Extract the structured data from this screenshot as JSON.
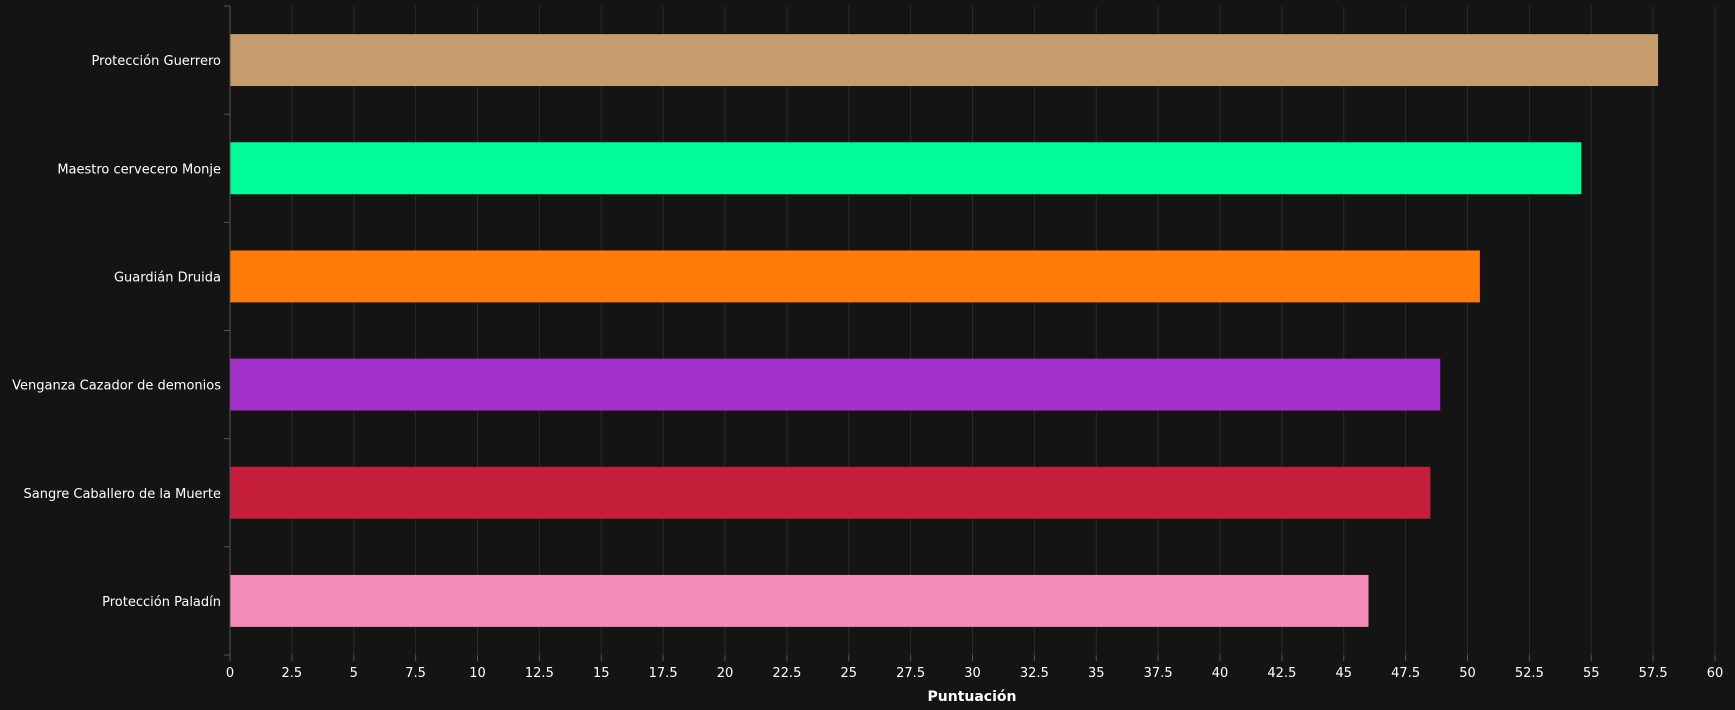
{
  "chart_data": {
    "type": "bar",
    "orientation": "horizontal",
    "categories": [
      "Protección Guerrero",
      "Maestro cervecero Monje",
      "Guardián Druida",
      "Venganza Cazador de demonios",
      "Sangre Caballero de la Muerte",
      "Protección Paladín"
    ],
    "values": [
      57.7,
      54.6,
      50.5,
      48.9,
      48.5,
      46.0
    ],
    "colors": [
      "#c69b6d",
      "#00ff98",
      "#ff7c0a",
      "#a330c9",
      "#c41e3a",
      "#f48cba"
    ],
    "title": "",
    "xlabel": "Puntuación",
    "ylabel": "",
    "xlim": [
      0,
      60
    ],
    "xticks": [
      "0",
      "2.5",
      "5",
      "7.5",
      "10",
      "12.5",
      "15",
      "17.5",
      "20",
      "22.5",
      "25",
      "27.5",
      "30",
      "32.5",
      "35",
      "37.5",
      "40",
      "42.5",
      "45",
      "47.5",
      "50",
      "52.5",
      "55",
      "57.5",
      "60"
    ],
    "grid": true,
    "background": "#141414",
    "grid_color": "#2a2a2a",
    "axis_color": "#555555",
    "text_color": "#ffffff"
  }
}
